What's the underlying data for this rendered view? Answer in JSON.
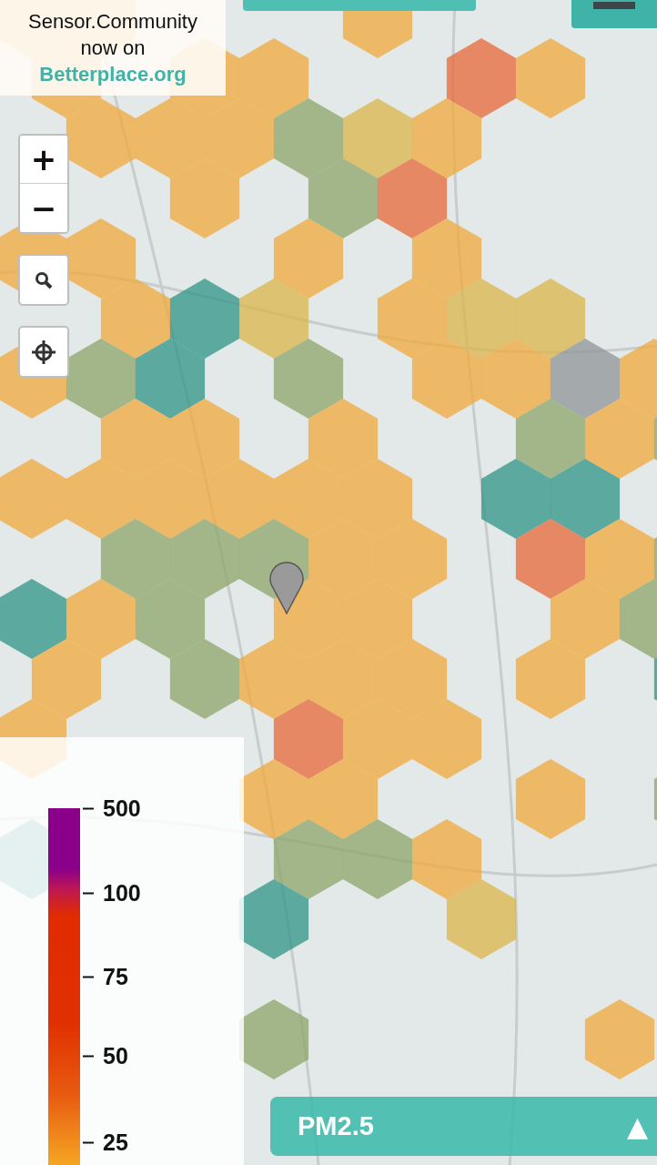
{
  "promo": {
    "line_1": "Sensor.Community",
    "line_2": "now on",
    "link": "Betterplace.org"
  },
  "map_controls": {
    "zoom_in": "+",
    "zoom_out": "−"
  },
  "legend": {
    "ticks": [
      "500",
      "100",
      "75",
      "50",
      "25"
    ]
  },
  "pollutant_bar": {
    "label": "PM2.5",
    "toggle": "▲"
  }
}
